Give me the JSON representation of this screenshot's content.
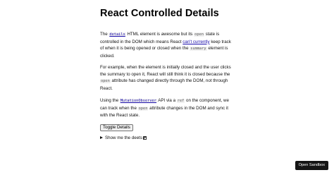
{
  "page": {
    "title": "React Controlled Details"
  },
  "para1": {
    "t1": "The ",
    "code_details": "details",
    "t2": " HTML element is awesome but its ",
    "code_open": "open",
    "t3": " state is controlled in the DOM which means React ",
    "link": "can't currently",
    "t4": " keep track of when it is being opened or closed when the ",
    "code_summary": "summary",
    "t5": " element is clicked."
  },
  "para2": {
    "t1": "For example, when the element is initially closed and the user clicks the summary to open it, React will still think it is closed because the ",
    "code_open": "open",
    "t2": " attribute has changed directly through the DOM, not through React."
  },
  "para3": {
    "t1": "Using the ",
    "code_mo": "MutationObserver",
    "t2": " API via a ",
    "code_ref": "ref",
    "t3": " on the component, we can track when the ",
    "code_open": "open",
    "t4": " attribute changes in the DOM and sync it with the React state."
  },
  "toggle": {
    "label": "Toggle Details"
  },
  "details": {
    "summary": "Show me the deets"
  },
  "sandbox": {
    "label": "Open Sandbox"
  }
}
